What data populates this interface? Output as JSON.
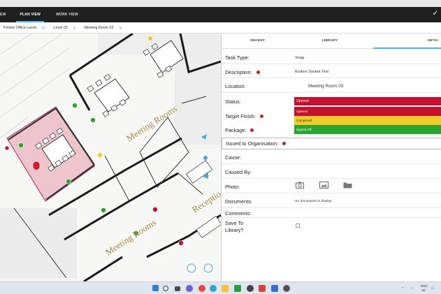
{
  "nav": {
    "tabs": [
      {
        "label": "EW"
      },
      {
        "label": "PLAN VIEW"
      },
      {
        "label": "WORK VIEW"
      }
    ],
    "confirm_icon": "check-icon"
  },
  "breadcrumb": [
    "Trimble Office Leeds",
    "Level 03",
    "Meeting Room 03"
  ],
  "plan": {
    "room_labels": [
      "Meeting Rooms",
      "Meeting Rooms",
      "Receptio"
    ],
    "highlight_color": "#e8a4b3",
    "location_pin_color": "#d21b2b"
  },
  "panel": {
    "tabs": [
      {
        "label": "RECENT"
      },
      {
        "label": "LIBRARY"
      },
      {
        "label": "DETAI"
      }
    ],
    "fields": {
      "task_type": {
        "label": "Task Type:",
        "value": "Snag"
      },
      "description": {
        "label": "Description:",
        "value": "Broken Socket Test"
      },
      "location": {
        "label": "Location:",
        "value": "Meeting Room 03"
      },
      "status": {
        "label": "Status:",
        "value": "Opened"
      },
      "target_finish": {
        "label": "Target Finish:"
      },
      "package": {
        "label": "Package:"
      },
      "issued_to": {
        "label": "Issued to Organisation:"
      },
      "cause": {
        "label": "Cause:"
      },
      "caused_by": {
        "label": "Caused By:"
      },
      "photo": {
        "label": "Photo:"
      },
      "documents": {
        "label": "Documents:",
        "value": "No documents to display"
      },
      "comments": {
        "label": "Comments:"
      },
      "save_to_library": {
        "label_line1": "Save To",
        "label_line2": "Library?",
        "checked": false
      }
    },
    "status_options": [
      {
        "label": "Opened",
        "color": "#c8102e"
      },
      {
        "label": "Completed",
        "color": "#f2cc26"
      },
      {
        "label": "Signed Off",
        "color": "#2aa531"
      }
    ],
    "required_color": "#c8202b"
  },
  "taskbar": {
    "tray": {
      "lang_line1": "ENG",
      "lang_line2": "UK"
    }
  }
}
